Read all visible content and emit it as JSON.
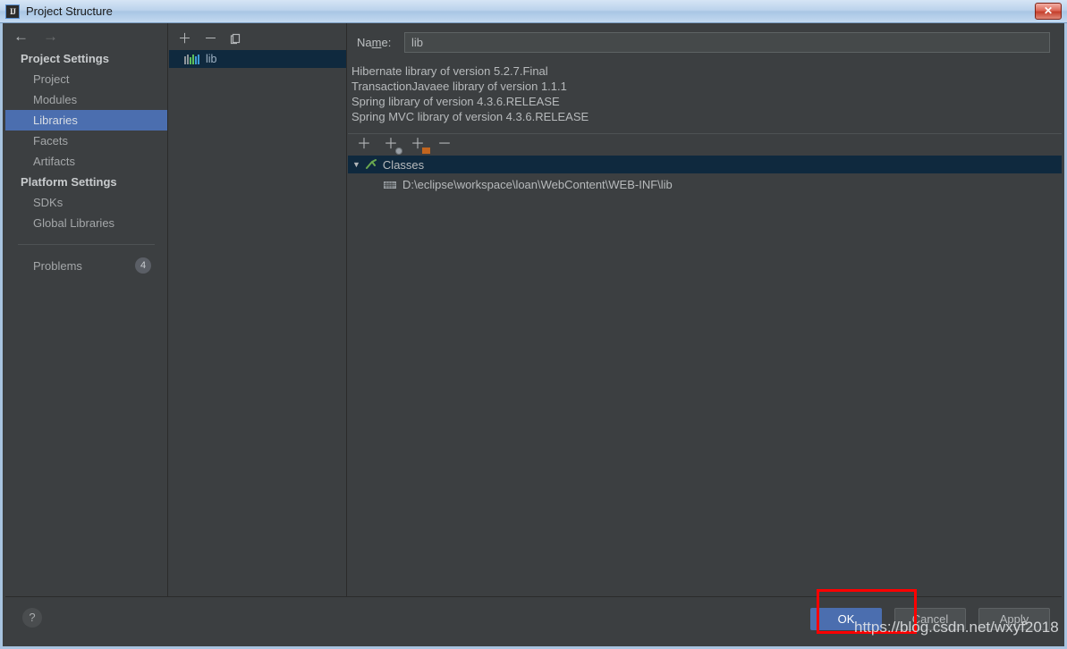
{
  "window": {
    "title": "Project Structure",
    "app_icon": "IJ",
    "close_label": "✕"
  },
  "nav": {
    "back_icon": "←",
    "forward_icon": "→"
  },
  "sidebar": {
    "groups": [
      {
        "header": "Project Settings",
        "items": [
          {
            "label": "Project",
            "selected": false
          },
          {
            "label": "Modules",
            "selected": false
          },
          {
            "label": "Libraries",
            "selected": true
          },
          {
            "label": "Facets",
            "selected": false
          },
          {
            "label": "Artifacts",
            "selected": false
          }
        ]
      },
      {
        "header": "Platform Settings",
        "items": [
          {
            "label": "SDKs",
            "selected": false
          },
          {
            "label": "Global Libraries",
            "selected": false
          }
        ]
      }
    ],
    "problems": {
      "label": "Problems",
      "count": "4"
    }
  },
  "mid_panel": {
    "toolbar": [
      {
        "name": "add-library-button",
        "glyph": "＋"
      },
      {
        "name": "remove-library-button",
        "glyph": "－"
      },
      {
        "name": "copy-library-button",
        "glyph": "❐"
      }
    ],
    "libraries": [
      {
        "label": "lib",
        "selected": true
      }
    ]
  },
  "detail": {
    "name_label_pre": "Na",
    "name_label_mnemonic": "m",
    "name_label_post": "e:",
    "name_value": "lib",
    "name_placeholder": "",
    "descriptions": [
      "Hibernate library of version 5.2.7.Final",
      "TransactionJavaee library of version 1.1.1",
      "Spring library of version 4.3.6.RELEASE",
      "Spring MVC library of version 4.3.6.RELEASE"
    ],
    "toolbar": [
      {
        "name": "add-root-button",
        "glyph": "＋"
      },
      {
        "name": "add-url-root-button",
        "glyph": "＋"
      },
      {
        "name": "add-directory-root-button",
        "glyph": "＋"
      },
      {
        "name": "remove-root-button",
        "glyph": "－"
      }
    ],
    "tree": {
      "caret": "▼",
      "root_label": "Classes",
      "path_label": "D:\\eclipse\\workspace\\loan\\WebContent\\WEB-INF\\lib"
    }
  },
  "footer": {
    "help_label": "?",
    "buttons": [
      {
        "label": "OK",
        "primary": true
      },
      {
        "label": "Cancel",
        "primary": false
      },
      {
        "label": "Apply",
        "primary": false
      }
    ]
  },
  "overlay": {
    "watermark": "https://blog.csdn.net/wxyf2018",
    "annotation_color": "#ff0000"
  },
  "colors": {
    "panel_bg": "#3c3f41",
    "selection_blue": "#4b6eaf",
    "tree_selection": "#0f293e",
    "titlebar_blue": "#a8c4e0"
  }
}
